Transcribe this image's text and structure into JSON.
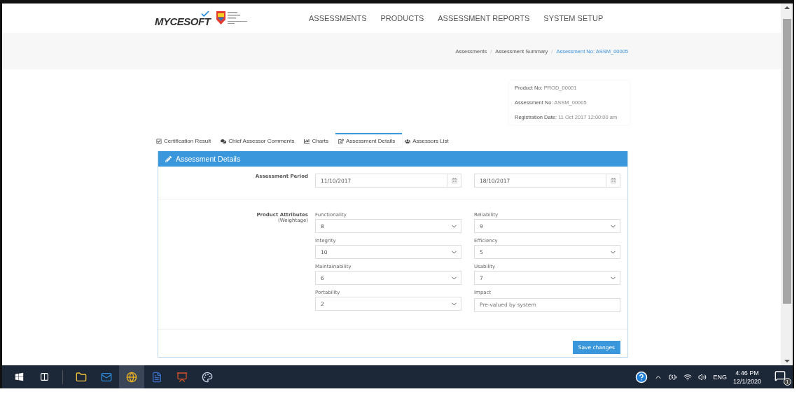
{
  "header": {
    "logo_text": "MYCESOFT",
    "nav": [
      {
        "label": "ASSESSMENTS"
      },
      {
        "label": "PRODUCTS"
      },
      {
        "label": "ASSESSMENT REPORTS"
      },
      {
        "label": "SYSTEM SETUP"
      }
    ]
  },
  "breadcrumb_separator": "/",
  "breadcrumb": [
    {
      "label": "Assessments",
      "current": false
    },
    {
      "label": "Assessment Summary",
      "current": false
    },
    {
      "label": "Assessment No: ASSM_00005",
      "current": true
    }
  ],
  "info": [
    {
      "label": "Product No:",
      "value": "PROD_00001"
    },
    {
      "label": "Assessment No:",
      "value": "ASSM_00005"
    },
    {
      "label": "Registration Date:",
      "value": "11 Oct 2017 12:00:00 am"
    }
  ],
  "tabs": [
    {
      "kind": "certificate",
      "label": "Certification Result",
      "selected": false
    },
    {
      "kind": "comments",
      "label": "Chief Assessor Comments",
      "selected": false
    },
    {
      "kind": "charts",
      "label": "Charts",
      "selected": false
    },
    {
      "kind": "edit",
      "label": "Assessment Details",
      "selected": true
    },
    {
      "kind": "users",
      "label": "Assessors List",
      "selected": false
    }
  ],
  "panel": {
    "title": "Assessment Details",
    "period": {
      "label": "Assessment Period",
      "start": "11/10/2017",
      "end": "18/10/2017"
    },
    "attributes": {
      "label": "Product Attributes",
      "sublabel": "(Weightage)",
      "fields": [
        {
          "kind": "select",
          "label": "Functionality",
          "value": "8"
        },
        {
          "kind": "select",
          "label": "Reliability",
          "value": "9"
        },
        {
          "kind": "select",
          "label": "Integrity",
          "value": "10"
        },
        {
          "kind": "select",
          "label": "Efficiency",
          "value": "5"
        },
        {
          "kind": "select",
          "label": "Maintainability",
          "value": "6"
        },
        {
          "kind": "select",
          "label": "Usability",
          "value": "7"
        },
        {
          "kind": "select",
          "label": "Portability",
          "value": "2"
        },
        {
          "kind": "text",
          "label": "Impact",
          "placeholder": "Pre-valued by system"
        }
      ]
    },
    "save_button": "Save changes"
  },
  "taskbar": {
    "apps": [
      {
        "kind": "folder",
        "selected": false
      },
      {
        "kind": "mail",
        "selected": false
      },
      {
        "kind": "browser",
        "selected": true
      },
      {
        "kind": "document",
        "selected": false
      },
      {
        "kind": "slides",
        "selected": false
      },
      {
        "kind": "paint",
        "selected": false
      }
    ],
    "language": "ENG",
    "time": "4:46 PM",
    "date": "12/1/2020",
    "notifications": "1"
  }
}
